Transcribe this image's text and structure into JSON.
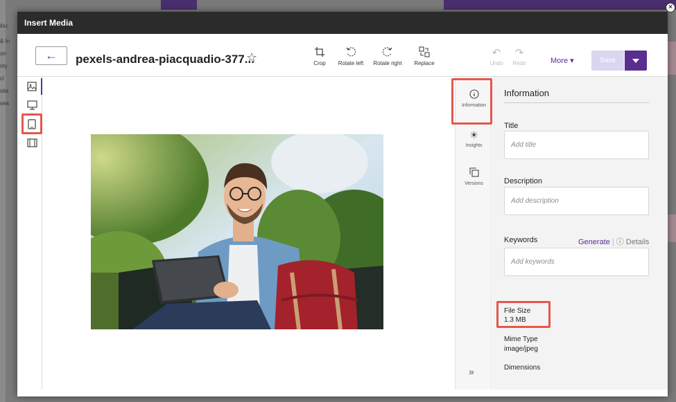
{
  "background_app": {
    "sidebar_fragments": [
      "ilsc",
      "& In",
      "on",
      "rity",
      "cl",
      "site",
      "sea"
    ]
  },
  "modal": {
    "title": "Insert Media",
    "close_icon": "close-circle-icon"
  },
  "toolbar": {
    "back_icon": "arrow-left-icon",
    "file_name": "pexels-andrea-piacquadio-377...",
    "favorite_icon": "star-outline-icon",
    "tools": [
      {
        "label": "Crop",
        "icon": "crop-icon"
      },
      {
        "label": "Rotate left",
        "icon": "rotate-left-icon"
      },
      {
        "label": "Rotate right",
        "icon": "rotate-right-icon"
      },
      {
        "label": "Replace",
        "icon": "replace-icon"
      }
    ],
    "undo_label": "Undo",
    "redo_label": "Redo",
    "more_label": "More",
    "save_label": "Save"
  },
  "left_rail": {
    "items": [
      "image-icon",
      "desktop-icon",
      "tablet-icon",
      "filmstrip-icon"
    ],
    "active_index": 0,
    "highlighted_index": 2
  },
  "right_rail": {
    "items": [
      {
        "label": "Information",
        "icon": "info-icon",
        "active": true
      },
      {
        "label": "Insights",
        "icon": "sun-icon"
      },
      {
        "label": "Versions",
        "icon": "versions-icon"
      }
    ],
    "expand_icon": "double-chevron-right-icon"
  },
  "info_panel": {
    "heading": "Information",
    "title_label": "Title",
    "title_placeholder": "Add title",
    "description_label": "Description",
    "description_placeholder": "Add description",
    "keywords_label": "Keywords",
    "generate_label": "Generate",
    "details_label": "Details",
    "keywords_placeholder": "Add keywords",
    "file_size_label": "File Size",
    "file_size_value": "1.3 MB",
    "mime_type_label": "Mime Type",
    "mime_type_value": "image/jpeg",
    "dimensions_label": "Dimensions"
  },
  "colors": {
    "accent": "#5a2e91",
    "highlight": "#e5574c",
    "header": "#2b2b2b"
  }
}
